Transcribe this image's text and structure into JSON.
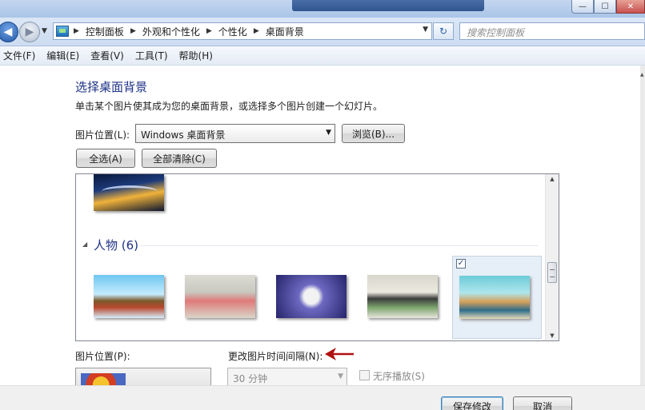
{
  "window": {
    "minimize_label": "—",
    "maximize_label": "☐",
    "close_label": "✕"
  },
  "address": {
    "crumbs": [
      "控制面板",
      "外观和个性化",
      "个性化",
      "桌面背景"
    ],
    "search_placeholder": "搜索控制面板"
  },
  "menu": {
    "items": [
      "文件(F)",
      "编辑(E)",
      "查看(V)",
      "工具(T)",
      "帮助(H)"
    ]
  },
  "page": {
    "title": "选择桌面背景",
    "description": "单击某个图片使其成为您的桌面背景，或选择多个图片创建一个幻灯片。",
    "location_label": "图片位置(L):",
    "location_value": "Windows 桌面背景",
    "browse_label": "浏览(B)...",
    "select_all_label": "全选(A)",
    "clear_all_label": "全部清除(C)"
  },
  "gallery": {
    "group_title": "人物 (6)",
    "selected_thumbnail_checked": true
  },
  "bottom": {
    "position_label": "图片位置(P):",
    "interval_label": "更改图片时间间隔(N):",
    "interval_value": "30 分钟",
    "shuffle_label": "无序播放(S)"
  },
  "footer": {
    "save_label": "保存修改",
    "cancel_label": "取消"
  },
  "colors": {
    "title_blue": "#1e3287",
    "annotation_arrow": "#b01010"
  }
}
